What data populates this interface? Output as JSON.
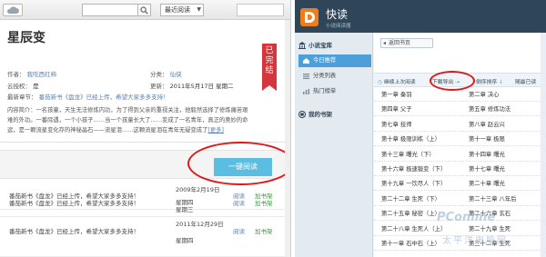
{
  "left": {
    "recent_label": "最近阅读",
    "book": {
      "title": "星辰变",
      "author_label": "作者：",
      "author": "我吃西红柿",
      "category_label": "分类：",
      "category": "仙侠",
      "cloud_label": "云授权：",
      "cloud_value": "是",
      "update_label": "更新：",
      "update_value": "2011年5月17日 星期二",
      "latest_label": "最新章节：",
      "latest_value": "番茄新书《盘龙》已经上传，希望大家多多支持！",
      "status_badge": "已完结"
    },
    "intro": {
      "label": "内容简介：",
      "text": "一名孩童，天生无法修炼内功，为了得到父亲的重视关注，他毅然选择了修炼痛苦艰难的外功。一番际遇，一个小孩子……当一个孩童长大了……变成了一名青年，真正的奥妙的命运，是一颗流星变化存的神秘晶石——流星泪……这颗流星泪在青年无疑变成了",
      "more": "[更多]"
    },
    "one_click_read": "一键阅读",
    "rows": [
      {
        "text": "番茄新书《盘龙》已经上传，希望大家多多支持！",
        "date": "2009年2月19日",
        "week": "星期四",
        "read": "阅读",
        "add": "加书架"
      },
      {
        "text": "番茄新书《盘龙》已经上传，希望大家多多支持！",
        "date": "",
        "week": "星期三",
        "read": "阅读",
        "add": "加书架"
      },
      {
        "text": "番茄新书《盘龙》已经上传，希望大家多多支持！",
        "date": "2011年12月29日",
        "week": "星期四",
        "read": "阅读",
        "add": "加书架"
      }
    ]
  },
  "right": {
    "brand": "快读",
    "brand_sub": "小说阅读器",
    "sidebar": {
      "treasury": "小说宝库",
      "items": [
        "今日推荐",
        "分类列表",
        "热门榜单"
      ],
      "shelf": "我的书架"
    },
    "back_button": "返回书页",
    "toolbar": {
      "continue": "继续上次阅读",
      "download": "下载导出",
      "reverse": "倒序排序",
      "random": "随最已读"
    },
    "chapters_col1": [
      "第一章 秦羽",
      "第四章 父子",
      "第七章 技师",
      "第十章 极限训练（上）",
      "第十三章 曙光（下）",
      "第十六章 极速锻变（下）",
      "第十九章 一饮尽人（下）",
      "第二十二章 生死（下）",
      "第二十五章 秘密（上）",
      "第二十八章 生死人（上）",
      "第十一章 石中石（上）"
    ],
    "chapters_col2": [
      "第二章 决心",
      "第五章 修炼功法",
      "第八章 赵云兴",
      "第十一章 极限",
      "第十四章 曙光",
      "第十七章 曙光",
      "第二十章 曙光",
      "第二十三章 八年后",
      "第二十六章 玄石",
      "第二十九章 生死",
      "第三十二章 生死"
    ]
  },
  "watermark": {
    "main": "PConline",
    "sub": "太平洋电脑网"
  }
}
